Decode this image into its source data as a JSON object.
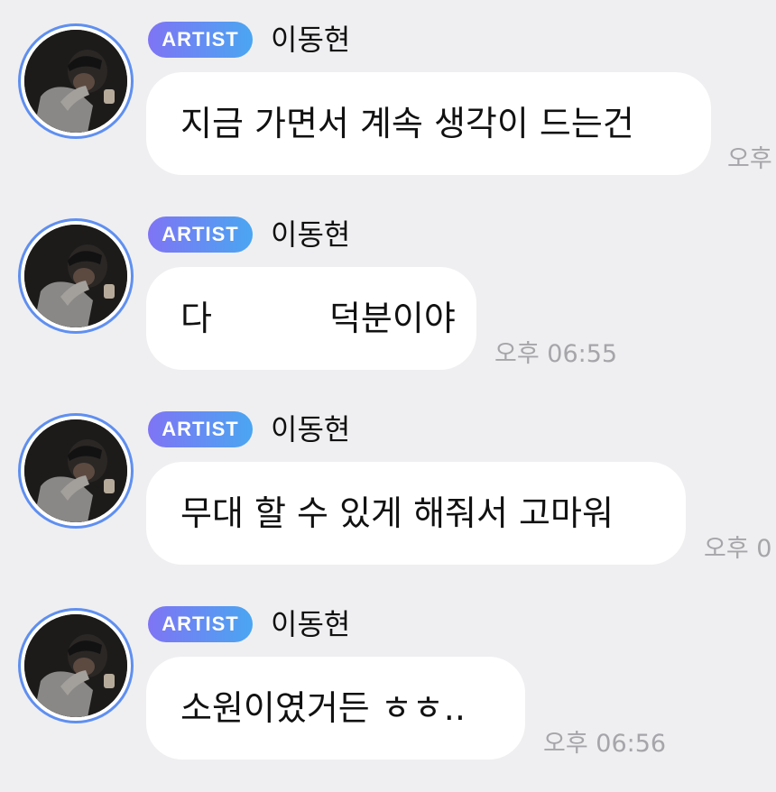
{
  "messages": [
    {
      "badge": "ARTIST",
      "sender": "이동현",
      "text": "지금 가면서 계속 생각이 드는건",
      "time": "오후"
    },
    {
      "badge": "ARTIST",
      "sender": "이동현",
      "text_start": "다",
      "text_end": "덕분이야",
      "time": "오후 06:55"
    },
    {
      "badge": "ARTIST",
      "sender": "이동현",
      "text": "무대 할 수 있게 해줘서 고마워",
      "time": "오후 0"
    },
    {
      "badge": "ARTIST",
      "sender": "이동현",
      "text": "소원이였거든 ㅎㅎ..",
      "time": "오후 06:56"
    }
  ],
  "colors": {
    "background": "#efeff1",
    "bubble": "#ffffff",
    "badge_gradient_start": "#7f74f4",
    "badge_gradient_end": "#4aa6f2",
    "avatar_ring": "#5f8ff0",
    "timestamp": "#a6a6aa"
  }
}
